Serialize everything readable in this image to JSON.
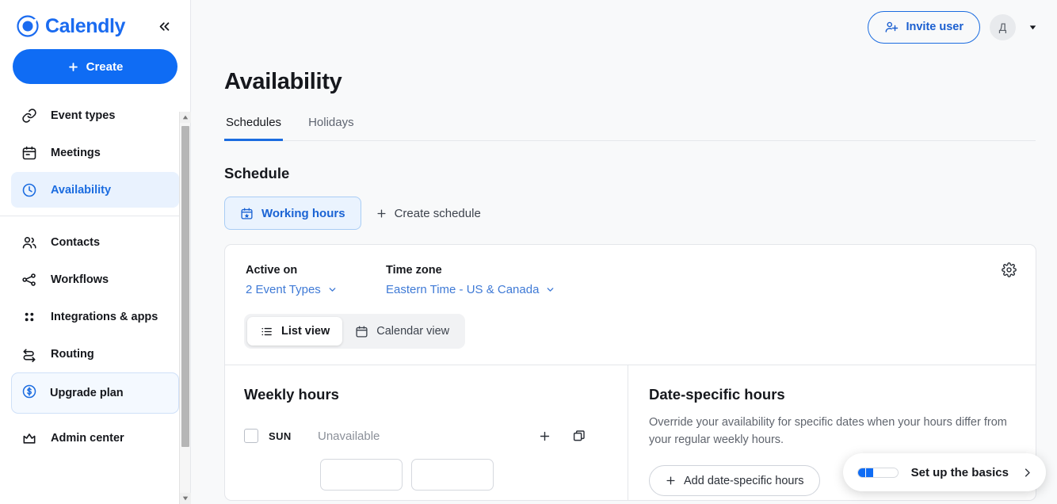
{
  "sidebar": {
    "logo_text": "Calendly",
    "collapse_label": "«",
    "create_label": "Create",
    "items": [
      {
        "label": "Event types",
        "icon": "link-icon",
        "active": false
      },
      {
        "label": "Meetings",
        "icon": "calendar-icon",
        "active": false
      },
      {
        "label": "Availability",
        "icon": "clock-icon",
        "active": true
      },
      {
        "label": "Contacts",
        "icon": "contacts-icon",
        "active": false
      },
      {
        "label": "Workflows",
        "icon": "workflows-icon",
        "active": false
      },
      {
        "label": "Integrations & apps",
        "icon": "grid-icon",
        "active": false
      },
      {
        "label": "Routing",
        "icon": "routing-icon",
        "active": false
      }
    ],
    "upgrade_label": "Upgrade plan",
    "admin_label": "Admin center"
  },
  "topbar": {
    "invite_label": "Invite user",
    "avatar_initial": "Д"
  },
  "page": {
    "title": "Availability",
    "tabs": [
      {
        "label": "Schedules",
        "active": true
      },
      {
        "label": "Holidays",
        "active": false
      }
    ],
    "section_title": "Schedule",
    "schedule_pill_label": "Working hours",
    "create_schedule_label": "Create schedule"
  },
  "card": {
    "active_on_label": "Active on",
    "active_on_value": "2 Event Types",
    "timezone_label": "Time zone",
    "timezone_value": "Eastern Time - US & Canada",
    "views": [
      {
        "label": "List view",
        "active": true
      },
      {
        "label": "Calendar view",
        "active": false
      }
    ],
    "weekly": {
      "title": "Weekly hours",
      "rows": [
        {
          "day": "SUN",
          "state": "Unavailable",
          "checked": false
        }
      ]
    },
    "date_specific": {
      "title": "Date-specific hours",
      "description": "Override your availability for specific dates when your hours differ from your regular weekly hours.",
      "add_label": "Add date-specific hours"
    }
  },
  "basics_widget": {
    "label": "Set up the basics",
    "steps_total": 5,
    "steps_done": 2
  },
  "colors": {
    "accent": "#0f6cf4",
    "accent_soft": "#e9f2fe",
    "link": "#3f7ad6",
    "text": "#16181d",
    "muted": "#8b9099",
    "page_bg": "#f8f9fa"
  }
}
